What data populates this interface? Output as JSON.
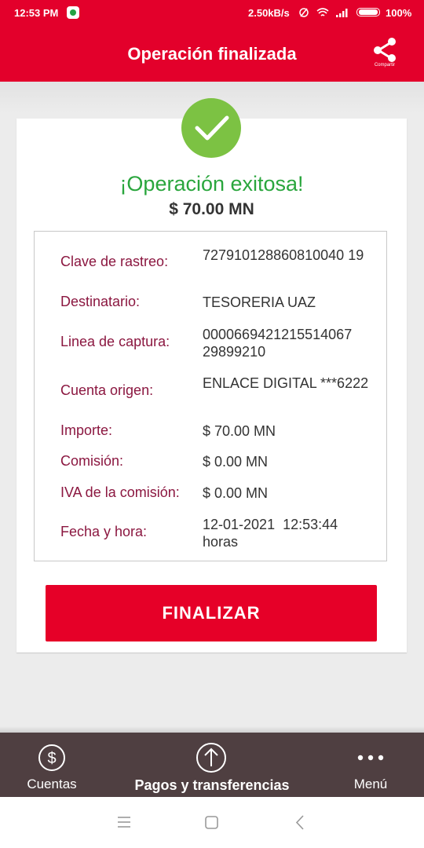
{
  "status_bar": {
    "time": "12:53 PM",
    "network_speed": "2.50kB/s",
    "battery": "100%"
  },
  "header": {
    "title": "Operación finalizada",
    "share_label": "Compartir"
  },
  "result": {
    "message": "¡Operación exitosa!",
    "amount": "$ 70.00 MN"
  },
  "details": [
    {
      "label": "Clave de rastreo:",
      "value": "727910128860810040 19"
    },
    {
      "label": "Destinatario:",
      "value": "TESORERIA UAZ"
    },
    {
      "label": "Linea de captura:",
      "value": "0000669421215514067 29899210"
    },
    {
      "label": "Cuenta origen:",
      "value": "ENLACE DIGITAL ***6222"
    },
    {
      "label": "Importe:",
      "value": "$ 70.00 MN"
    },
    {
      "label": "Comisión:",
      "value": "$ 0.00 MN"
    },
    {
      "label": "IVA de la comisión:",
      "value": "$ 0.00 MN"
    },
    {
      "label": "Fecha y hora:",
      "value": "12-01-2021  12:53:44 horas"
    }
  ],
  "finish_button": "FINALIZAR",
  "bottom_nav": {
    "items": [
      {
        "label": "Cuentas",
        "icon": "dollar-circle-icon"
      },
      {
        "label": "Pagos y transferencias",
        "icon": "arrow-up-circle-icon"
      },
      {
        "label": "Menú",
        "icon": "more-dots-icon"
      }
    ]
  },
  "colors": {
    "brand_red": "#e3002b",
    "success_green": "#2aa63d",
    "label_wine": "#8b1740",
    "nav_bg": "#4f3f41"
  }
}
